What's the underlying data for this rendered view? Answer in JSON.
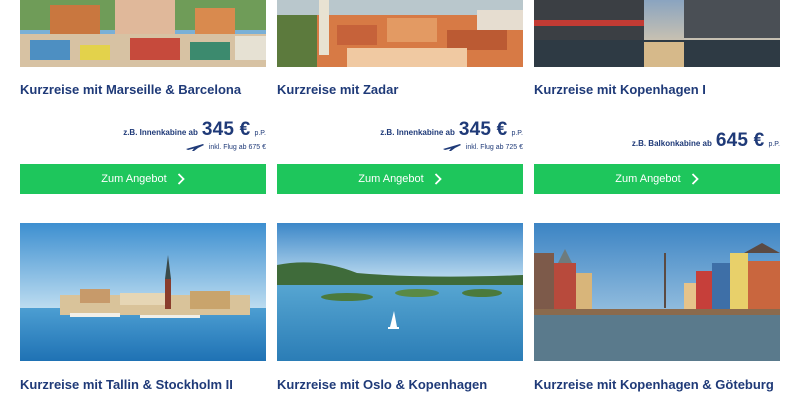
{
  "offers": [
    {
      "title": "Kurzreise mit Marseille & Barcelona",
      "cabin_prefix": "z.B. Innenkabine ab",
      "price": "345 €",
      "per_person": "p.P.",
      "flight": "inkl. Flug ab 675 €",
      "cta": "Zum Angebot"
    },
    {
      "title": "Kurzreise mit Zadar",
      "cabin_prefix": "z.B. Innenkabine ab",
      "price": "345 €",
      "per_person": "p.P.",
      "flight": "inkl. Flug ab 725 €",
      "cta": "Zum Angebot"
    },
    {
      "title": "Kurzreise mit Kopenhagen I",
      "cabin_prefix": "z.B. Balkonkabine ab",
      "price": "645 €",
      "per_person": "p.P.",
      "cta": "Zum Angebot"
    },
    {
      "title": "Kurzreise mit Tallin & Stockholm II"
    },
    {
      "title": "Kurzreise mit Oslo & Kopenhagen"
    },
    {
      "title": "Kurzreise mit Kopenhagen & Göteburg"
    }
  ],
  "icons": {
    "plane": "plane-icon",
    "chevron": "chevron-right-icon"
  },
  "colors": {
    "accent_green": "#1ec65c",
    "title_blue": "#1f3a78"
  }
}
